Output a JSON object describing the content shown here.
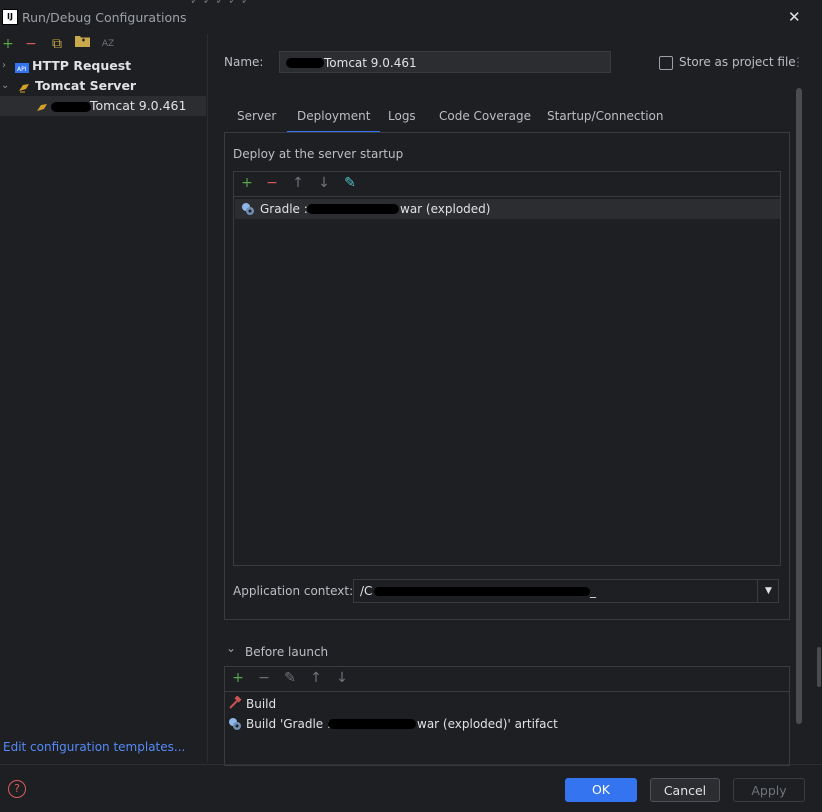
{
  "window": {
    "title": "Run/Debug Configurations",
    "app_icon": "IJ",
    "close_glyph": "✕"
  },
  "top_fragment": "✓ ✓ ✓ ✓ ✓",
  "left_toolbar": {
    "add": "+",
    "remove": "−",
    "copy": "⧉",
    "folder": "📁",
    "sort": "AZ"
  },
  "tree": [
    {
      "label": "HTTP Request",
      "chevron": "›",
      "icon": "http-icon"
    },
    {
      "label": "Tomcat Server",
      "chevron": "⌄",
      "icon": "tomcat-icon"
    },
    {
      "label": "Tomcat 9.0.461",
      "chevron": "",
      "icon": "tomcat-icon",
      "selected": true
    }
  ],
  "edit_templates": "Edit configuration templates...",
  "help_glyph": "?",
  "name_label": "Name:",
  "name_value": "Tomcat 9.0.461",
  "store_label": "Store as project file",
  "store_checked": false,
  "kebab": "⋮",
  "tabs": [
    {
      "label": "Server"
    },
    {
      "label": "Deployment",
      "active": true
    },
    {
      "label": "Logs"
    },
    {
      "label": "Code Coverage"
    },
    {
      "label": "Startup/Connection"
    }
  ],
  "deploy_title": "Deploy at the server startup",
  "deploy_toolbar": {
    "add": "+",
    "remove": "−",
    "up": "↑",
    "down": "↓",
    "edit": "✎"
  },
  "deploy_items": [
    {
      "prefix": "Gradle : ",
      "suffix": "war (exploded)"
    }
  ],
  "app_context_label": "Application context:",
  "app_context_value": "/C",
  "app_context_tail": "_",
  "dropdown_glyph": "▼",
  "before_launch": {
    "label": "Before launch",
    "chevron": "⌄"
  },
  "bl_toolbar": {
    "add": "+",
    "remove": "−",
    "edit": "✎",
    "up": "↑",
    "down": "↓"
  },
  "bl_items": [
    {
      "label": "Build",
      "icon": "hammer-icon"
    },
    {
      "label_prefix": "Build 'Gradle : ",
      "label_suffix": "war (exploded)' artifact",
      "icon": "artifact-icon"
    }
  ],
  "buttons": {
    "ok": "OK",
    "cancel": "Cancel",
    "apply": "Apply"
  },
  "colors": {
    "accent": "#3574f0",
    "bg": "#1e1f22",
    "link": "#548af7",
    "add_green": "#57a64a",
    "remove_red": "#db5c5c"
  }
}
